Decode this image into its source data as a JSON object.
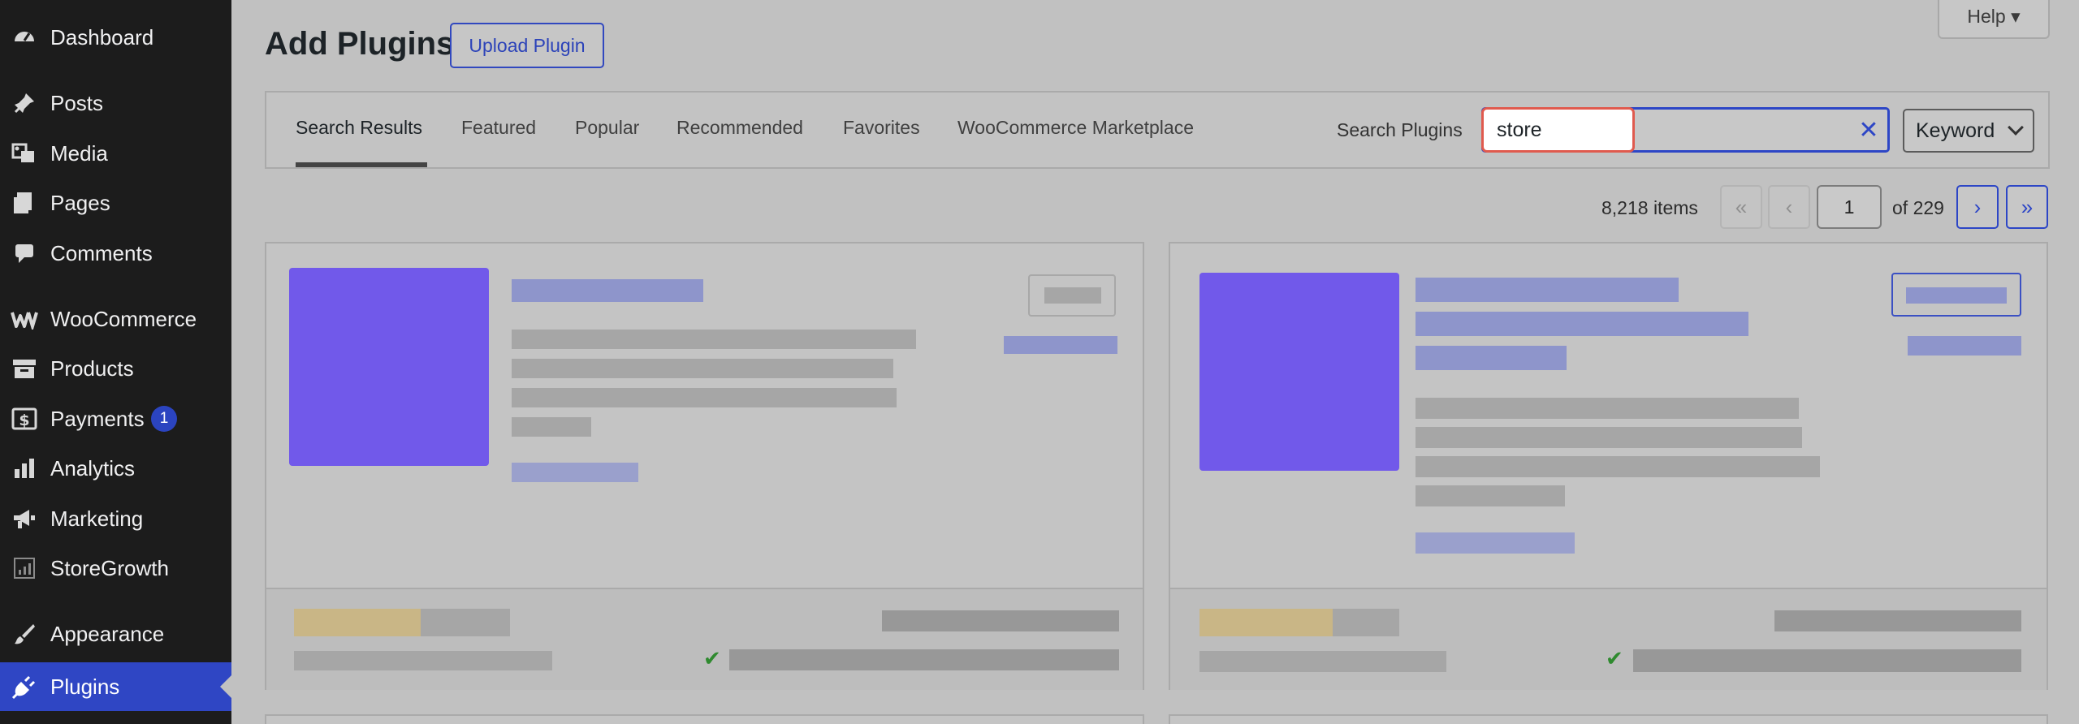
{
  "sidebar": {
    "items": [
      {
        "label": "Dashboard",
        "icon": "dashboard-icon"
      },
      {
        "label": "Posts",
        "icon": "pin-icon"
      },
      {
        "label": "Media",
        "icon": "media-icon"
      },
      {
        "label": "Pages",
        "icon": "pages-icon"
      },
      {
        "label": "Comments",
        "icon": "comment-icon"
      },
      {
        "label": "WooCommerce",
        "icon": "woo-icon"
      },
      {
        "label": "Products",
        "icon": "archive-icon"
      },
      {
        "label": "Payments",
        "icon": "dollar-icon",
        "badge": "1"
      },
      {
        "label": "Analytics",
        "icon": "bar-chart-icon"
      },
      {
        "label": "Marketing",
        "icon": "megaphone-icon"
      },
      {
        "label": "StoreGrowth",
        "icon": "storegrowth-icon"
      },
      {
        "label": "Appearance",
        "icon": "brush-icon"
      },
      {
        "label": "Plugins",
        "icon": "plug-icon",
        "active": true
      }
    ]
  },
  "header": {
    "title": "Add Plugins",
    "upload_label": "Upload Plugin",
    "help_label": "Help ▾"
  },
  "filter": {
    "tabs": [
      "Search Results",
      "Featured",
      "Popular",
      "Recommended",
      "Favorites",
      "WooCommerce Marketplace"
    ],
    "current_tab": "Search Results",
    "search_label": "Search Plugins",
    "search_value": "store",
    "clear_glyph": "✕",
    "search_type": "Keyword"
  },
  "pagination": {
    "items": "8,218 items",
    "first": "«",
    "prev": "‹",
    "current": "1",
    "of_total": "of 229",
    "next": "›",
    "last": "»"
  },
  "colors": {
    "accent": "#2f46c4",
    "highlight": "#e05a4e",
    "plugin_thumb": "#7159ea",
    "sidebar_bg": "#1c1c1c"
  },
  "cards": {
    "check_glyph": "✔"
  }
}
